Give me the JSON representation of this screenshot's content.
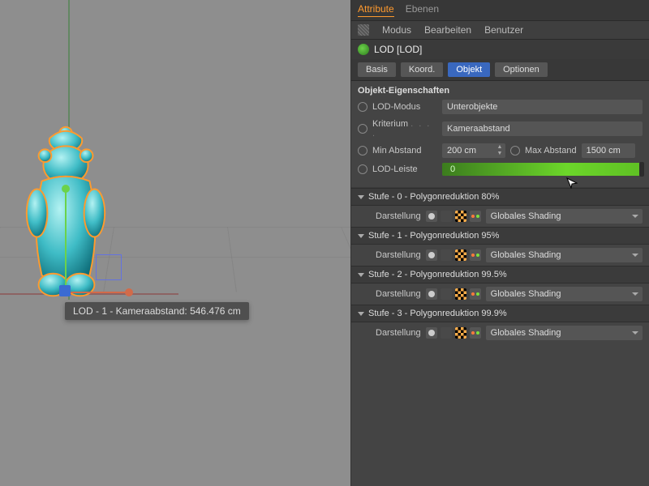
{
  "tabs": {
    "attribute": "Attribute",
    "layers": "Ebenen"
  },
  "menu": {
    "mode": "Modus",
    "edit": "Bearbeiten",
    "user": "Benutzer"
  },
  "object": {
    "name": "LOD [LOD]"
  },
  "subtabs": {
    "basis": "Basis",
    "koord": "Koord.",
    "objekt": "Objekt",
    "optionen": "Optionen"
  },
  "section": "Objekt-Eigenschaften",
  "props": {
    "lod_mode_label": "LOD-Modus",
    "lod_mode_value": "Unterobjekte",
    "criterion_label": "Kriterium",
    "criterion_value": "Kameraabstand",
    "min_dist_label": "Min Abstand",
    "min_dist_value": "200 cm",
    "max_dist_label": "Max Abstand",
    "max_dist_value": "1500 cm",
    "lod_bar_label": "LOD-Leiste",
    "lod_bar_value": "0"
  },
  "levels": [
    {
      "title": "Stufe - 0 - Polygonreduktion 80%",
      "display_label": "Darstellung",
      "display_value": "Globales Shading"
    },
    {
      "title": "Stufe - 1 - Polygonreduktion 95%",
      "display_label": "Darstellung",
      "display_value": "Globales Shading"
    },
    {
      "title": "Stufe - 2 - Polygonreduktion 99.5%",
      "display_label": "Darstellung",
      "display_value": "Globales Shading"
    },
    {
      "title": "Stufe - 3 - Polygonreduktion 99.9%",
      "display_label": "Darstellung",
      "display_value": "Globales Shading"
    }
  ],
  "tooltip": "LOD - 1 - Kameraabstand: 546.476 cm"
}
